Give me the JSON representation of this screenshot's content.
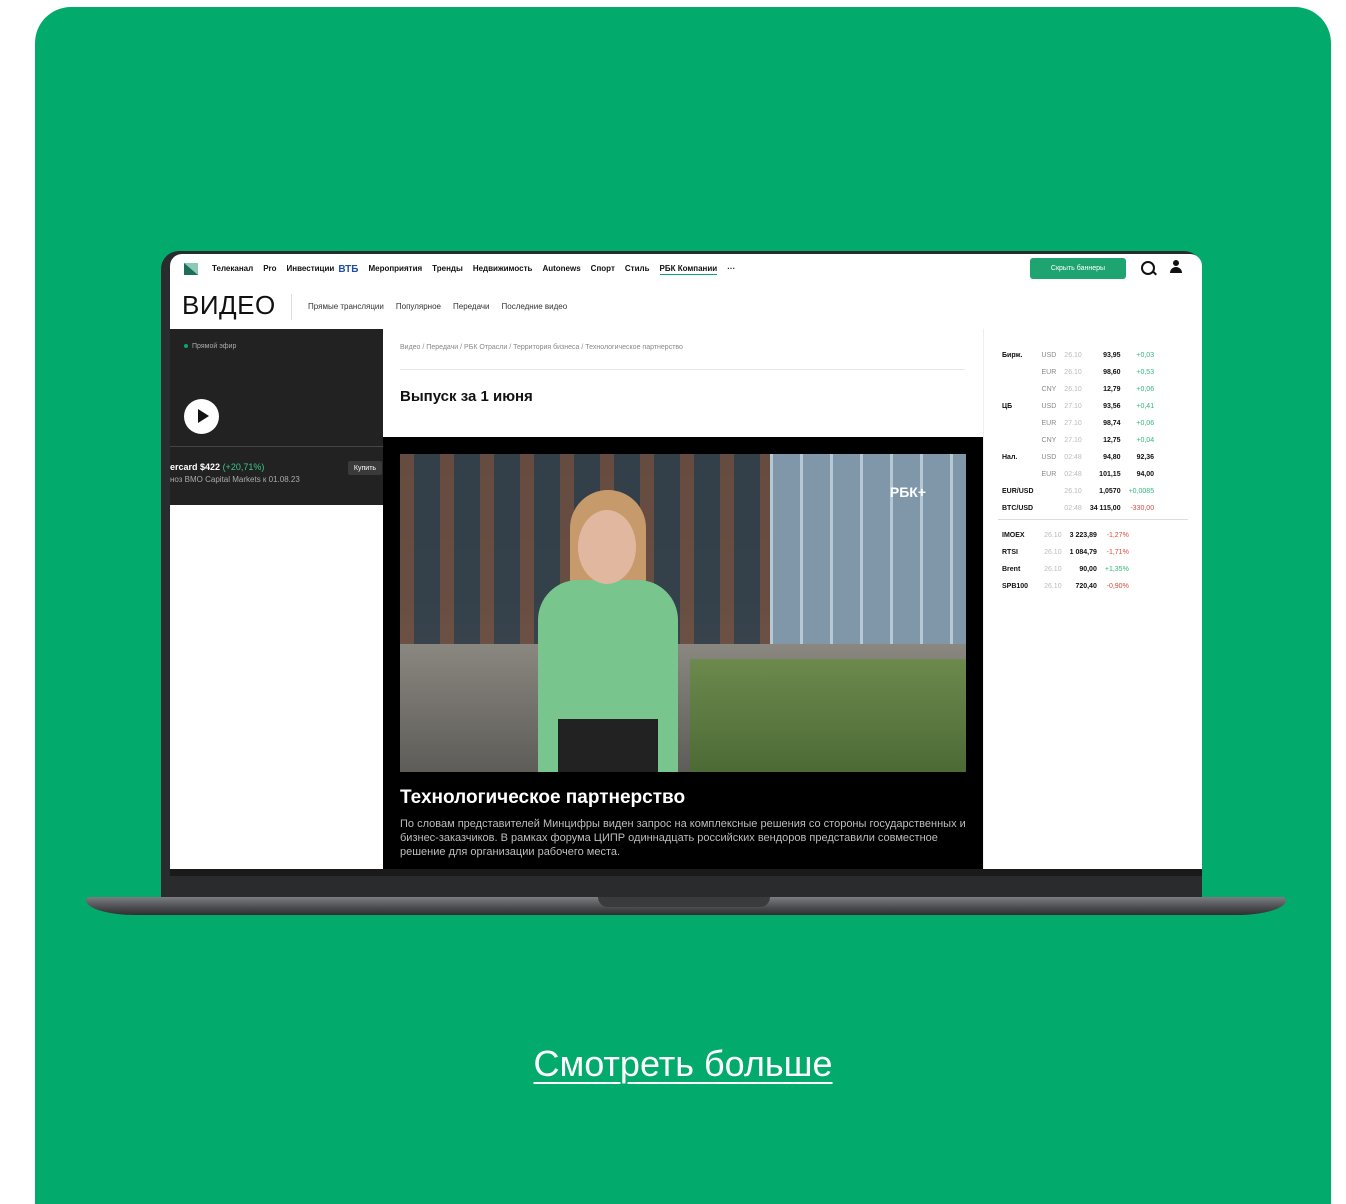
{
  "colors": {
    "accent": "#02ab6c",
    "up": "#2fb879",
    "down": "#e0493b"
  },
  "more_link": "Смотреть больше",
  "topnav": {
    "logo_icon": "rbc-logo-icon",
    "items": [
      "Телеканал",
      "Pro",
      "Инвестиции",
      "ВТБ",
      "Мероприятия",
      "Тренды",
      "Недвижимость",
      "Autonews",
      "Спорт",
      "Стиль",
      "РБК Компании",
      "···"
    ],
    "hide_banners": "Скрыть баннеры"
  },
  "section": {
    "title": "ВИДЕО",
    "tabs": [
      "Прямые трансляции",
      "Популярное",
      "Передачи",
      "Последние видео"
    ]
  },
  "left": {
    "live_label": "Прямой эфир",
    "ticker": "ercard $422",
    "ticker_change": "(+20,71%)",
    "ticker_note": "ноз BMO Capital Markets к 01.08.23",
    "buy": "Купить"
  },
  "main": {
    "breadcrumbs": "Видео / Передачи / РБК Отрасли / Территория бизнеса / Технологическое партнерство",
    "episode": "Выпуск за 1 июня",
    "watermark": "РБК+",
    "video_title": "Технологическое партнерство",
    "video_desc": "По словам представителей Минцифры виден запрос на комплексные решения со стороны государственных и бизнес-заказчиков. В рамках форума ЦИПР одиннадцать российских вендоров представили совместное решение для организации рабочего места."
  },
  "quotes": {
    "rows": [
      {
        "group": "Бирж.",
        "cur": "USD",
        "date": "26.10",
        "value": "93,95",
        "change": "+0,03",
        "dir": "up",
        "extra": ""
      },
      {
        "group": "",
        "cur": "EUR",
        "date": "26.10",
        "value": "98,60",
        "change": "+0,53",
        "dir": "up",
        "extra": ""
      },
      {
        "group": "",
        "cur": "CNY",
        "date": "26.10",
        "value": "12,79",
        "change": "+0,06",
        "dir": "up",
        "extra": ""
      },
      {
        "group": "ЦБ",
        "cur": "USD",
        "date": "27.10",
        "value": "93,56",
        "change": "+0,41",
        "dir": "up",
        "extra": ""
      },
      {
        "group": "",
        "cur": "EUR",
        "date": "27.10",
        "value": "98,74",
        "change": "+0,06",
        "dir": "up",
        "extra": ""
      },
      {
        "group": "",
        "cur": "CNY",
        "date": "27.10",
        "value": "12,75",
        "change": "+0,04",
        "dir": "up",
        "extra": ""
      },
      {
        "group": "Нал.",
        "cur": "USD",
        "date": "02:48",
        "value": "94,80",
        "change": "92,36",
        "dir": "flat",
        "extra": ""
      },
      {
        "group": "",
        "cur": "EUR",
        "date": "02:48",
        "value": "101,15",
        "change": "94,00",
        "dir": "flat",
        "extra": ""
      },
      {
        "group": "EUR/USD",
        "cur": "",
        "date": "26.10",
        "value": "1,0570",
        "change": "+0,0085",
        "dir": "up",
        "extra": ""
      },
      {
        "group": "BTC/USD",
        "cur": "",
        "date": "02:48",
        "value": "34 115,00",
        "change": "-330,00",
        "dir": "down",
        "extra": ""
      }
    ],
    "indices": [
      {
        "name": "IMOEX",
        "date": "26.10",
        "value": "3 223,89",
        "change": "-1,27%",
        "dir": "down"
      },
      {
        "name": "RTSI",
        "date": "26.10",
        "value": "1 084,79",
        "change": "-1,71%",
        "dir": "down"
      },
      {
        "name": "Brent",
        "date": "26.10",
        "value": "90,00",
        "change": "+1,35%",
        "dir": "up"
      },
      {
        "name": "SPB100",
        "date": "26.10",
        "value": "720,40",
        "change": "-0,90%",
        "dir": "down"
      }
    ]
  }
}
